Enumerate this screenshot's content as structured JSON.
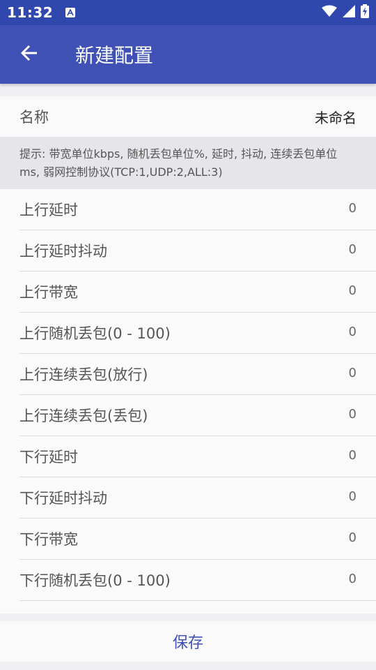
{
  "status_bar": {
    "time": "11:32",
    "notification_icon": "a-icon",
    "wifi_icon": "wifi-icon",
    "signal_icon": "signal-icon",
    "battery_icon": "battery-charging-icon"
  },
  "app_bar": {
    "back_icon": "arrow-left-icon",
    "title": "新建配置",
    "color": "#3f51b5"
  },
  "name_row": {
    "label": "名称",
    "value": "未命名"
  },
  "hint": "提示: 带宽单位kbps, 随机丢包单位%, 延时, 抖动, 连续丢包单位ms, 弱网控制协议(TCP:1,UDP:2,ALL:3)",
  "items": [
    {
      "label": "上行延时",
      "value": "0"
    },
    {
      "label": "上行延时抖动",
      "value": "0"
    },
    {
      "label": "上行带宽",
      "value": "0"
    },
    {
      "label": "上行随机丢包(0 - 100)",
      "value": "0"
    },
    {
      "label": "上行连续丢包(放行)",
      "value": "0"
    },
    {
      "label": "上行连续丢包(丢包)",
      "value": "0"
    },
    {
      "label": "下行延时",
      "value": "0"
    },
    {
      "label": "下行延时抖动",
      "value": "0"
    },
    {
      "label": "下行带宽",
      "value": "0"
    },
    {
      "label": "下行随机丢包(0 - 100)",
      "value": "0"
    }
  ],
  "save_label": "保存",
  "accent_color": "#3f51b5"
}
